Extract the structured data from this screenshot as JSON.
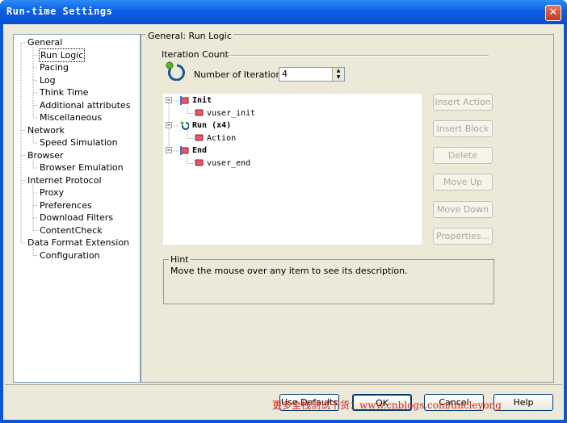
{
  "window": {
    "title": "Run-time Settings"
  },
  "tree": [
    {
      "label": "General",
      "indent": 0
    },
    {
      "label": "Run Logic",
      "indent": 1,
      "selected": true
    },
    {
      "label": "Pacing",
      "indent": 1
    },
    {
      "label": "Log",
      "indent": 1
    },
    {
      "label": "Think Time",
      "indent": 1
    },
    {
      "label": "Additional attributes",
      "indent": 1
    },
    {
      "label": "Miscellaneous",
      "indent": 1
    },
    {
      "label": "Network",
      "indent": 0
    },
    {
      "label": "Speed Simulation",
      "indent": 1
    },
    {
      "label": "Browser",
      "indent": 0
    },
    {
      "label": "Browser Emulation",
      "indent": 1
    },
    {
      "label": "Internet Protocol",
      "indent": 0
    },
    {
      "label": "Proxy",
      "indent": 1
    },
    {
      "label": "Preferences",
      "indent": 1
    },
    {
      "label": "Download Filters",
      "indent": 1
    },
    {
      "label": "ContentCheck",
      "indent": 1
    },
    {
      "label": "Data Format Extension",
      "indent": 0
    },
    {
      "label": "Configuration",
      "indent": 1
    }
  ],
  "panel": {
    "header": "General: Run Logic",
    "iteration_section": "Iteration Count",
    "iterations_label": "Number of Iterations:",
    "iterations_value": "4"
  },
  "flow": [
    {
      "label": "Init",
      "level": 0,
      "icon": "init-icon"
    },
    {
      "label": "vuser_init",
      "level": 1,
      "icon": "action-icon"
    },
    {
      "label": "Run (x4)",
      "level": 0,
      "icon": "run-icon"
    },
    {
      "label": "Action",
      "level": 1,
      "icon": "action-icon"
    },
    {
      "label": "End",
      "level": 0,
      "icon": "end-icon"
    },
    {
      "label": "vuser_end",
      "level": 1,
      "icon": "action-icon"
    }
  ],
  "side_buttons": [
    "Insert Action",
    "Insert Block",
    "Delete",
    "Move Up",
    "Move Down",
    "Properties..."
  ],
  "hint": {
    "label": "Hint",
    "text": "Move the mouse over any item to see its description."
  },
  "bottom_buttons": {
    "use_defaults": "Use Defaults",
    "ok": "OK",
    "cancel": "Cancel",
    "help": "Help"
  },
  "watermark": "更多全栈测试干货：www.cnblogs.com/uncleyong"
}
